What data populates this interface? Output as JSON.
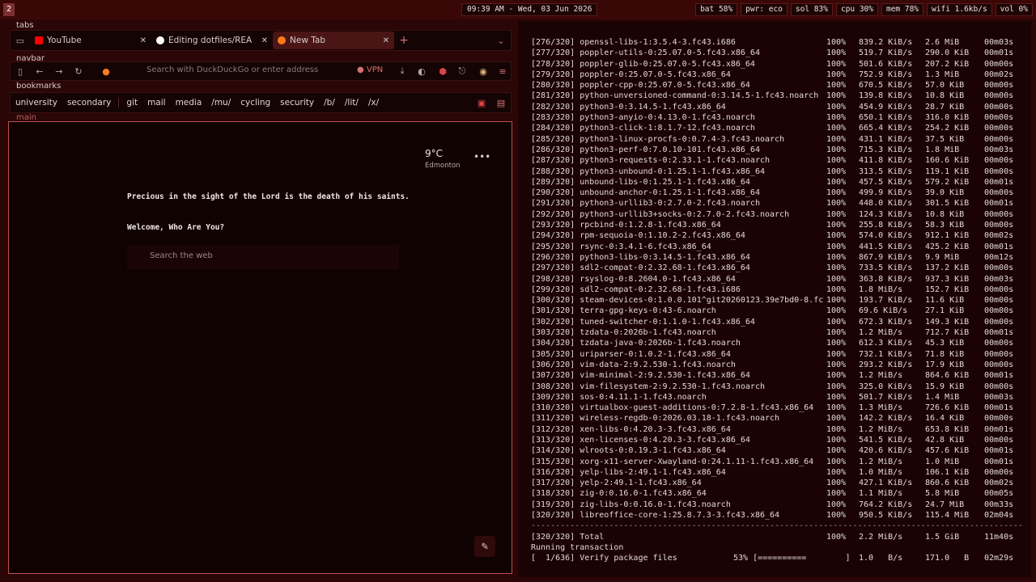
{
  "topbar": {
    "workspace": "2",
    "clock": "09:39 AM - Wed, 03 Jun 2026",
    "stats": [
      "bat 58%",
      "pwr: eco",
      "sol 83%",
      "cpu 30%",
      "mem 78%",
      "wifi 1.6kb/s",
      "vol 0%"
    ]
  },
  "browser": {
    "labels": {
      "tabs": "tabs",
      "navbar": "navbar",
      "bookmarks": "bookmarks",
      "main": "main"
    },
    "tabs": [
      {
        "label": "YouTube",
        "icon": "youtube-icon",
        "color": "#ff0000"
      },
      {
        "label": "Editing dotfiles/REA",
        "icon": "github-icon",
        "color": "#ffffff"
      },
      {
        "label": "New Tab",
        "icon": "firefox-icon",
        "color": "#ff7a1a",
        "active": true
      }
    ],
    "navbar": {
      "url_placeholder": "Search with DuckDuckGo or enter address",
      "vpn_label": "VPN"
    },
    "bookmarks": [
      "university",
      "secondary",
      "git",
      "mail",
      "media",
      "/mu/",
      "cycling",
      "security",
      "/b/",
      "/lit/",
      "/x/"
    ],
    "newtab": {
      "temp": "9°C",
      "city": "Edmonton",
      "quote": "Precious in the sight of the Lord is the death of his saints.",
      "welcome": "Welcome, Who Are You?",
      "search_placeholder": "Search the web"
    }
  },
  "terminal": {
    "rows": [
      [
        "[276/320] openssl-libs-1:3.5.4-3.fc43.i686",
        "100%",
        "839.2 KiB/s",
        "2.6 MiB",
        "00m03s"
      ],
      [
        "[277/320] poppler-utils-0:25.07.0-5.fc43.x86_64",
        "100%",
        "519.7 KiB/s",
        "290.0 KiB",
        "00m01s"
      ],
      [
        "[278/320] poppler-glib-0:25.07.0-5.fc43.x86_64",
        "100%",
        "501.6 KiB/s",
        "207.2 KiB",
        "00m00s"
      ],
      [
        "[279/320] poppler-0:25.07.0-5.fc43.x86_64",
        "100%",
        "752.9 KiB/s",
        "1.3 MiB",
        "00m02s"
      ],
      [
        "[280/320] poppler-cpp-0:25.07.0-5.fc43.x86_64",
        "100%",
        "670.5 KiB/s",
        "57.0 KiB",
        "00m00s"
      ],
      [
        "[281/320] python-unversioned-command-0:3.14.5-1.fc43.noarch",
        "100%",
        "139.8 KiB/s",
        "10.8 KiB",
        "00m00s"
      ],
      [
        "[282/320] python3-0:3.14.5-1.fc43.x86_64",
        "100%",
        "454.9 KiB/s",
        "28.7 KiB",
        "00m00s"
      ],
      [
        "[283/320] python3-anyio-0:4.13.0-1.fc43.noarch",
        "100%",
        "650.1 KiB/s",
        "316.0 KiB",
        "00m00s"
      ],
      [
        "[284/320] python3-click-1:8.1.7-12.fc43.noarch",
        "100%",
        "665.4 KiB/s",
        "254.2 KiB",
        "00m00s"
      ],
      [
        "[285/320] python3-linux-procfs-0:0.7.4-3.fc43.noarch",
        "100%",
        "431.1 KiB/s",
        "37.5 KiB",
        "00m00s"
      ],
      [
        "[286/320] python3-perf-0:7.0.10-101.fc43.x86_64",
        "100%",
        "715.3 KiB/s",
        "1.8 MiB",
        "00m03s"
      ],
      [
        "[287/320] python3-requests-0:2.33.1-1.fc43.noarch",
        "100%",
        "411.8 KiB/s",
        "160.6 KiB",
        "00m00s"
      ],
      [
        "[288/320] python3-unbound-0:1.25.1-1.fc43.x86_64",
        "100%",
        "313.5 KiB/s",
        "119.1 KiB",
        "00m00s"
      ],
      [
        "[289/320] unbound-libs-0:1.25.1-1.fc43.x86_64",
        "100%",
        "457.5 KiB/s",
        "579.2 KiB",
        "00m01s"
      ],
      [
        "[290/320] unbound-anchor-0:1.25.1-1.fc43.x86_64",
        "100%",
        "499.9 KiB/s",
        "39.0 KiB",
        "00m00s"
      ],
      [
        "[291/320] python3-urllib3-0:2.7.0-2.fc43.noarch",
        "100%",
        "448.0 KiB/s",
        "301.5 KiB",
        "00m01s"
      ],
      [
        "[292/320] python3-urllib3+socks-0:2.7.0-2.fc43.noarch",
        "100%",
        "124.3 KiB/s",
        "10.8 KiB",
        "00m00s"
      ],
      [
        "[293/320] rpcbind-0:1.2.8-1.fc43.x86_64",
        "100%",
        "255.8 KiB/s",
        "58.3 KiB",
        "00m00s"
      ],
      [
        "[294/320] rpm-sequoia-0:1.10.2-2.fc43.x86_64",
        "100%",
        "574.0 KiB/s",
        "912.1 KiB",
        "00m02s"
      ],
      [
        "[295/320] rsync-0:3.4.1-6.fc43.x86_64",
        "100%",
        "441.5 KiB/s",
        "425.2 KiB",
        "00m01s"
      ],
      [
        "[296/320] python3-libs-0:3.14.5-1.fc43.x86_64",
        "100%",
        "867.9 KiB/s",
        "9.9 MiB",
        "00m12s"
      ],
      [
        "[297/320] sdl2-compat-0:2.32.68-1.fc43.x86_64",
        "100%",
        "733.5 KiB/s",
        "137.2 KiB",
        "00m00s"
      ],
      [
        "[298/320] rsyslog-0:8.2604.0-1.fc43.x86_64",
        "100%",
        "363.8 KiB/s",
        "937.3 KiB",
        "00m03s"
      ],
      [
        "[299/320] sdl2-compat-0:2.32.68-1.fc43.i686",
        "100%",
        "1.8 MiB/s",
        "152.7 KiB",
        "00m00s"
      ],
      [
        "[300/320] steam-devices-0:1.0.0.101^git20260123.39e7bd0-8.fc",
        "100%",
        "193.7 KiB/s",
        "11.6 KiB",
        "00m00s"
      ],
      [
        "[301/320] terra-gpg-keys-0:43-6.noarch",
        "100%",
        "69.6 KiB/s",
        "27.1 KiB",
        "00m00s"
      ],
      [
        "[302/320] tuned-switcher-0:1.1.0-1.fc43.x86_64",
        "100%",
        "672.3 KiB/s",
        "149.3 KiB",
        "00m00s"
      ],
      [
        "[303/320] tzdata-0:2026b-1.fc43.noarch",
        "100%",
        "1.2 MiB/s",
        "712.7 KiB",
        "00m01s"
      ],
      [
        "[304/320] tzdata-java-0:2026b-1.fc43.noarch",
        "100%",
        "612.3 KiB/s",
        "45.3 KiB",
        "00m00s"
      ],
      [
        "[305/320] uriparser-0:1.0.2-1.fc43.x86_64",
        "100%",
        "732.1 KiB/s",
        "71.8 KiB",
        "00m00s"
      ],
      [
        "[306/320] vim-data-2:9.2.530-1.fc43.noarch",
        "100%",
        "293.2 KiB/s",
        "17.9 KiB",
        "00m00s"
      ],
      [
        "[307/320] vim-minimal-2:9.2.530-1.fc43.x86_64",
        "100%",
        "1.2 MiB/s",
        "864.6 KiB",
        "00m01s"
      ],
      [
        "[308/320] vim-filesystem-2:9.2.530-1.fc43.noarch",
        "100%",
        "325.0 KiB/s",
        "15.9 KiB",
        "00m00s"
      ],
      [
        "[309/320] sos-0:4.11.1-1.fc43.noarch",
        "100%",
        "501.7 KiB/s",
        "1.4 MiB",
        "00m03s"
      ],
      [
        "[310/320] virtualbox-guest-additions-0:7.2.8-1.fc43.x86_64",
        "100%",
        "1.3 MiB/s",
        "726.6 KiB",
        "00m01s"
      ],
      [
        "[311/320] wireless-regdb-0:2026.03.18-1.fc43.noarch",
        "100%",
        "142.2 KiB/s",
        "16.4 KiB",
        "00m00s"
      ],
      [
        "[312/320] xen-libs-0:4.20.3-3.fc43.x86_64",
        "100%",
        "1.2 MiB/s",
        "653.8 KiB",
        "00m01s"
      ],
      [
        "[313/320] xen-licenses-0:4.20.3-3.fc43.x86_64",
        "100%",
        "541.5 KiB/s",
        "42.8 KiB",
        "00m00s"
      ],
      [
        "[314/320] wlroots-0:0.19.3-1.fc43.x86_64",
        "100%",
        "420.6 KiB/s",
        "457.6 KiB",
        "00m01s"
      ],
      [
        "[315/320] xorg-x11-server-Xwayland-0:24.1.11-1.fc43.x86_64",
        "100%",
        "1.2 MiB/s",
        "1.0 MiB",
        "00m01s"
      ],
      [
        "[316/320] yelp-libs-2:49.1-1.fc43.x86_64",
        "100%",
        "1.0 MiB/s",
        "106.1 KiB",
        "00m00s"
      ],
      [
        "[317/320] yelp-2:49.1-1.fc43.x86_64",
        "100%",
        "427.1 KiB/s",
        "860.6 KiB",
        "00m02s"
      ],
      [
        "[318/320] zig-0:0.16.0-1.fc43.x86_64",
        "100%",
        "1.1 MiB/s",
        "5.8 MiB",
        "00m05s"
      ],
      [
        "[319/320] zig-libs-0:0.16.0-1.fc43.noarch",
        "100%",
        "764.2 KiB/s",
        "24.7 MiB",
        "00m33s"
      ],
      [
        "[320/320] libreoffice-core-1:25.8.7.3-3.fc43.x86_64",
        "100%",
        "950.5 KiB/s",
        "115.4 MiB",
        "02m04s"
      ]
    ],
    "divider": "------------------------------------------------------------------------------------------------------",
    "total": [
      "[320/320] Total",
      "100%",
      "2.2 MiB/s",
      "1.5 GiB",
      "11m40s"
    ],
    "running": "Running transaction",
    "verify": [
      "[  1/636] Verify package files",
      "53% [==========        ]",
      "1.0   B/s",
      "171.0   B",
      "02m29s"
    ]
  }
}
